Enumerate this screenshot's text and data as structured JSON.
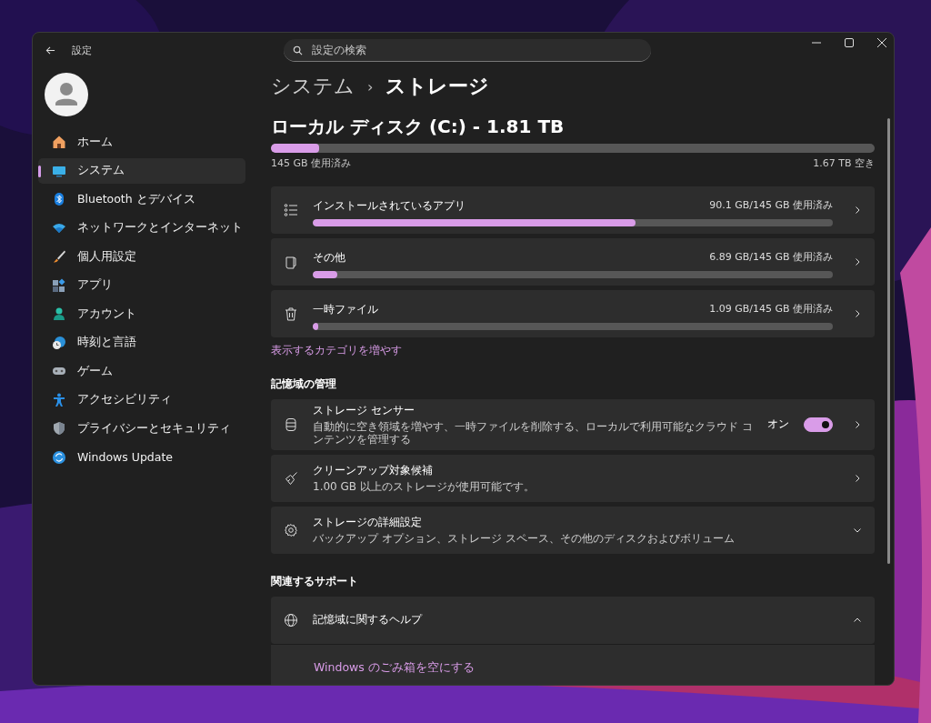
{
  "window": {
    "title": "設定"
  },
  "search": {
    "placeholder": "設定の検索"
  },
  "sidebar": {
    "items": [
      {
        "label": "ホーム",
        "selected": false
      },
      {
        "label": "システム",
        "selected": true
      },
      {
        "label": "Bluetooth とデバイス",
        "selected": false
      },
      {
        "label": "ネットワークとインターネット",
        "selected": false
      },
      {
        "label": "個人用設定",
        "selected": false
      },
      {
        "label": "アプリ",
        "selected": false
      },
      {
        "label": "アカウント",
        "selected": false
      },
      {
        "label": "時刻と言語",
        "selected": false
      },
      {
        "label": "ゲーム",
        "selected": false
      },
      {
        "label": "アクセシビリティ",
        "selected": false
      },
      {
        "label": "プライバシーとセキュリティ",
        "selected": false
      },
      {
        "label": "Windows Update",
        "selected": false
      }
    ]
  },
  "breadcrumb": {
    "parent": "システム",
    "separator": "›",
    "current": "ストレージ"
  },
  "disk": {
    "title": "ローカル ディスク (C:) - 1.81 TB",
    "level": 0.08,
    "used": "145 GB 使用済み",
    "free": "1.67 TB 空き"
  },
  "categories": [
    {
      "label": "インストールされているアプリ",
      "usage": "90.1 GB/145 GB 使用済み",
      "level": 0.62
    },
    {
      "label": "その他",
      "usage": "6.89 GB/145 GB 使用済み",
      "level": 0.048
    },
    {
      "label": "一時ファイル",
      "usage": "1.09 GB/145 GB 使用済み",
      "level": 0.01
    }
  ],
  "more_link": "表示するカテゴリを増やす",
  "management": {
    "heading": "記憶域の管理",
    "items": [
      {
        "kind": "toggle",
        "title": "ストレージ センサー",
        "description": "自動的に空き領域を増やす、一時ファイルを削除する、ローカルで利用可能なクラウド コンテンツを管理する",
        "state_label": "オン",
        "on": true
      },
      {
        "kind": "link",
        "title": "クリーンアップ対象候補",
        "description": "1.00 GB 以上のストレージが使用可能です。"
      },
      {
        "kind": "expander",
        "title": "ストレージの詳細設定",
        "description": "バックアップ オプション、ストレージ スペース、その他のディスクおよびボリューム",
        "expanded": false
      }
    ]
  },
  "support": {
    "heading": "関連するサポート",
    "items": [
      {
        "title": "記憶域に関するヘルプ",
        "expanded": true,
        "links": [
          "Windows のごみ箱を空にする"
        ]
      }
    ]
  }
}
